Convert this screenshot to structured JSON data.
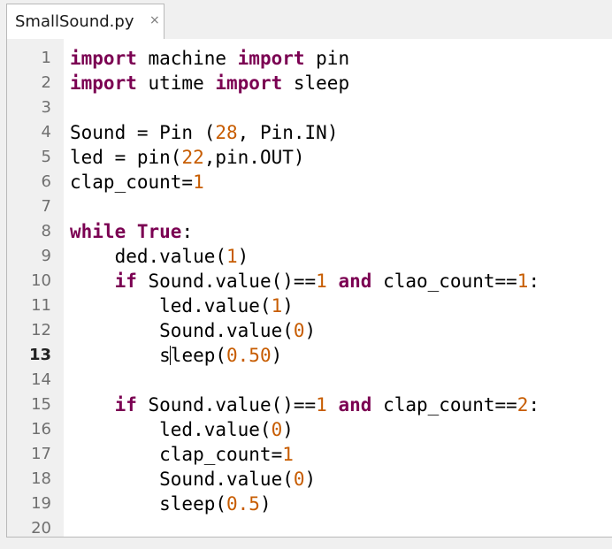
{
  "tab": {
    "title": "SmallSound.py",
    "close_glyph": "×"
  },
  "editor": {
    "current_line": 13,
    "lines": [
      {
        "n": "1",
        "tokens": [
          {
            "t": "import",
            "c": "kw"
          },
          {
            "t": " machine "
          },
          {
            "t": "import",
            "c": "kw"
          },
          {
            "t": " pin"
          }
        ]
      },
      {
        "n": "2",
        "tokens": [
          {
            "t": "import",
            "c": "kw"
          },
          {
            "t": " utime "
          },
          {
            "t": "import",
            "c": "kw"
          },
          {
            "t": " sleep"
          }
        ]
      },
      {
        "n": "3",
        "tokens": []
      },
      {
        "n": "4",
        "tokens": [
          {
            "t": "Sound = Pin ("
          },
          {
            "t": "28",
            "c": "num"
          },
          {
            "t": ", Pin.IN)"
          }
        ]
      },
      {
        "n": "5",
        "tokens": [
          {
            "t": "led = pin("
          },
          {
            "t": "22",
            "c": "num"
          },
          {
            "t": ",pin.OUT)"
          }
        ]
      },
      {
        "n": "6",
        "tokens": [
          {
            "t": "clap_count="
          },
          {
            "t": "1",
            "c": "num"
          }
        ]
      },
      {
        "n": "7",
        "tokens": []
      },
      {
        "n": "8",
        "tokens": [
          {
            "t": "while",
            "c": "kw"
          },
          {
            "t": " "
          },
          {
            "t": "True",
            "c": "kw"
          },
          {
            "t": ":"
          }
        ]
      },
      {
        "n": "9",
        "tokens": [
          {
            "t": "    ded.value("
          },
          {
            "t": "1",
            "c": "num"
          },
          {
            "t": ")"
          }
        ]
      },
      {
        "n": "10",
        "tokens": [
          {
            "t": "    "
          },
          {
            "t": "if",
            "c": "kw"
          },
          {
            "t": " Sound.value()=="
          },
          {
            "t": "1",
            "c": "num"
          },
          {
            "t": " "
          },
          {
            "t": "and",
            "c": "kw"
          },
          {
            "t": " clao_count=="
          },
          {
            "t": "1",
            "c": "num"
          },
          {
            "t": ":"
          }
        ]
      },
      {
        "n": "11",
        "tokens": [
          {
            "t": "        led.value("
          },
          {
            "t": "1",
            "c": "num"
          },
          {
            "t": ")"
          }
        ]
      },
      {
        "n": "12",
        "tokens": [
          {
            "t": "        Sound.value("
          },
          {
            "t": "0",
            "c": "num"
          },
          {
            "t": ")"
          }
        ]
      },
      {
        "n": "13",
        "tokens": [
          {
            "t": "        s"
          },
          {
            "cursor": true
          },
          {
            "t": "leep("
          },
          {
            "t": "0.50",
            "c": "num"
          },
          {
            "t": ")"
          }
        ]
      },
      {
        "n": "14",
        "tokens": []
      },
      {
        "n": "15",
        "tokens": [
          {
            "t": "    "
          },
          {
            "t": "if",
            "c": "kw"
          },
          {
            "t": " Sound.value()=="
          },
          {
            "t": "1",
            "c": "num"
          },
          {
            "t": " "
          },
          {
            "t": "and",
            "c": "kw"
          },
          {
            "t": " clap_count=="
          },
          {
            "t": "2",
            "c": "num"
          },
          {
            "t": ":"
          }
        ]
      },
      {
        "n": "16",
        "tokens": [
          {
            "t": "        led.value("
          },
          {
            "t": "0",
            "c": "num"
          },
          {
            "t": ")"
          }
        ]
      },
      {
        "n": "17",
        "tokens": [
          {
            "t": "        clap_count="
          },
          {
            "t": "1",
            "c": "num"
          }
        ]
      },
      {
        "n": "18",
        "tokens": [
          {
            "t": "        Sound.value("
          },
          {
            "t": "0",
            "c": "num"
          },
          {
            "t": ")"
          }
        ]
      },
      {
        "n": "19",
        "tokens": [
          {
            "t": "        sleep("
          },
          {
            "t": "0.5",
            "c": "num"
          },
          {
            "t": ")"
          }
        ]
      },
      {
        "n": "20",
        "tokens": []
      }
    ]
  },
  "colors": {
    "keyword": "#7b0052",
    "number": "#c75c00",
    "gutter_bg": "#f0f0f0",
    "line_number": "#707070"
  }
}
